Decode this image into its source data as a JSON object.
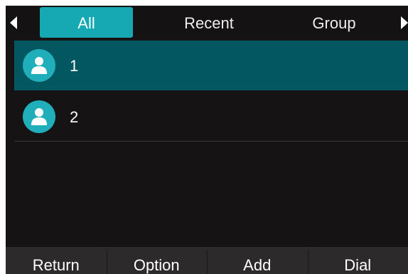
{
  "tabs": {
    "items": [
      {
        "label": "All",
        "active": true
      },
      {
        "label": "Recent",
        "active": false
      },
      {
        "label": "Group",
        "active": false
      }
    ],
    "left_arrow_icon": "triangle-left-icon",
    "right_arrow_icon": "triangle-right-icon"
  },
  "contacts": [
    {
      "name": "1",
      "selected": true,
      "icon": "person-icon"
    },
    {
      "name": "2",
      "selected": false,
      "icon": "person-icon"
    }
  ],
  "softkeys": [
    {
      "label": "Return"
    },
    {
      "label": "Option"
    },
    {
      "label": "Add"
    },
    {
      "label": "Dial"
    }
  ],
  "colors": {
    "accent": "#17a9b3",
    "selected_row": "#035760",
    "background": "#151313",
    "softkey_bar": "#2c2a2a"
  }
}
